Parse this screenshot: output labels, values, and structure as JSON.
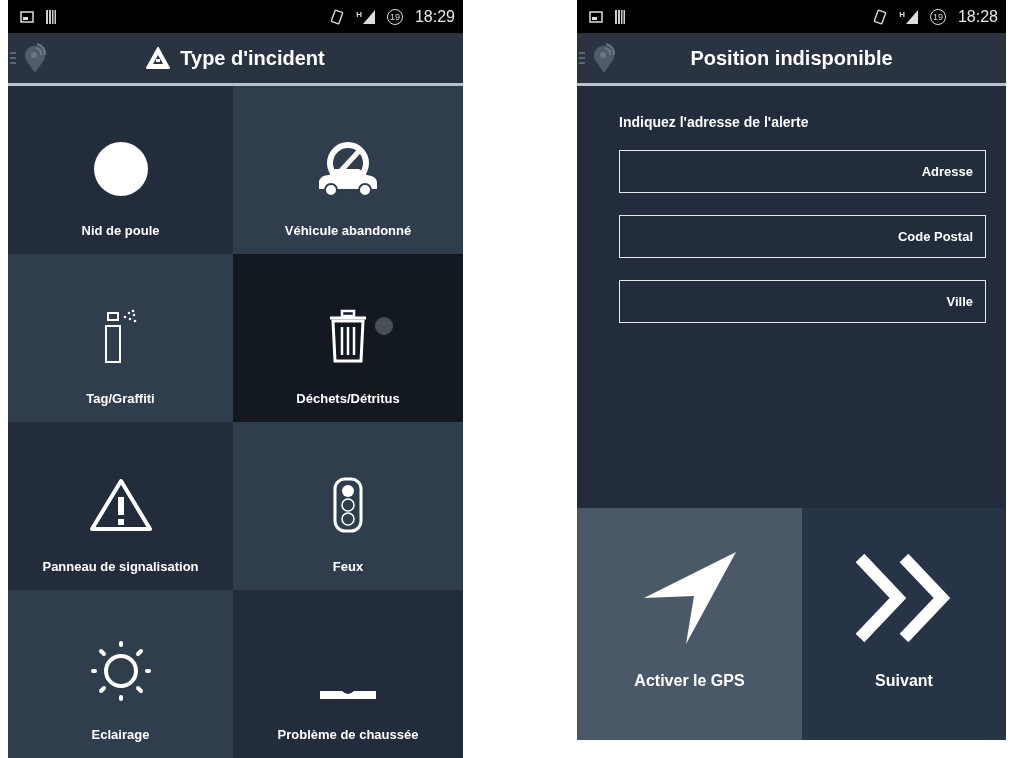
{
  "screens": [
    {
      "status_bar": {
        "network": "H",
        "badge": "19",
        "time": "18:29"
      },
      "title": "Type d'incident",
      "title_icon": true,
      "tiles": [
        {
          "label": "Nid de poule",
          "selected": false
        },
        {
          "label": "Véhicule abandonné",
          "selected": false
        },
        {
          "label": "Tag/Graffiti",
          "selected": false
        },
        {
          "label": "Déchets/Détritus",
          "selected": true
        },
        {
          "label": "Panneau de signalisation",
          "selected": false
        },
        {
          "label": "Feux",
          "selected": false
        },
        {
          "label": "Eclairage",
          "selected": false
        },
        {
          "label": "Problème de chaussée",
          "selected": false
        }
      ]
    },
    {
      "status_bar": {
        "network": "H",
        "badge": "19",
        "time": "18:28"
      },
      "title": "Position indisponible",
      "title_icon": false,
      "prompt": "Indiquez l'adresse de l'alerte",
      "fields": [
        {
          "placeholder": "Adresse"
        },
        {
          "placeholder": "Code Postal"
        },
        {
          "placeholder": "Ville"
        }
      ],
      "buttons": [
        {
          "label": "Activer le GPS"
        },
        {
          "label": "Suivant"
        }
      ]
    }
  ]
}
